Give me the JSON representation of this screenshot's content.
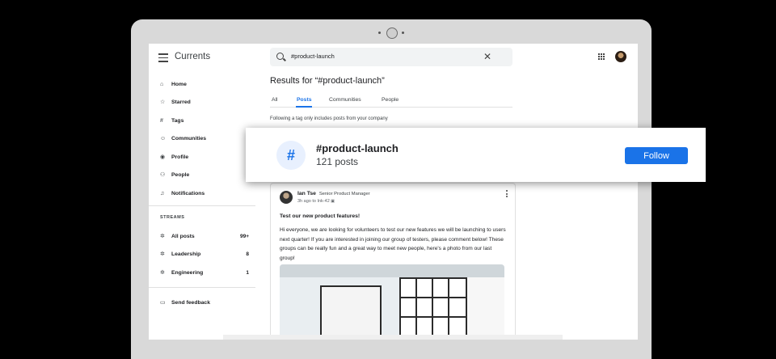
{
  "app": {
    "title": "Currents"
  },
  "search": {
    "query": "#product-launch",
    "clear_icon": "close-icon"
  },
  "sidebar": {
    "items": [
      {
        "label": "Home",
        "icon": "home-icon"
      },
      {
        "label": "Starred",
        "icon": "star-icon"
      },
      {
        "label": "Tags",
        "icon": "hashtag-icon"
      },
      {
        "label": "Communities",
        "icon": "communities-icon"
      },
      {
        "label": "Profile",
        "icon": "profile-icon"
      },
      {
        "label": "People",
        "icon": "people-icon"
      },
      {
        "label": "Notifications",
        "icon": "bell-icon"
      }
    ],
    "streams_label": "STREAMS",
    "streams": [
      {
        "label": "All posts",
        "count": "99+"
      },
      {
        "label": "Leadership",
        "count": "8"
      },
      {
        "label": "Engineering",
        "count": "1"
      }
    ],
    "feedback": "Send feedback"
  },
  "main": {
    "results_title": "Results for “#product-launch”",
    "tabs": [
      "All",
      "Posts",
      "Communities",
      "People"
    ],
    "active_tab": "Posts",
    "notice": "Following a tag only includes posts from your company"
  },
  "tag_card": {
    "name": "#product-launch",
    "count": "121 posts",
    "follow_label": "Follow"
  },
  "post": {
    "author": "Ian Tse",
    "role": "Senior Product Manager",
    "meta": "3h ago to Ink-42",
    "title": "Test our new product features!",
    "body": "Hi everyone, we are looking for volunteers to test our new features we will be launching to users next quarter! If you are interested in joining our group of testers, please comment below! These groups can be really fun and a great way to meet new people, here's a photo from our last group!"
  },
  "colors": {
    "accent": "#1a73e8",
    "tag_circle_bg": "#e8f0fe",
    "bezel": "#d9d9d9"
  }
}
